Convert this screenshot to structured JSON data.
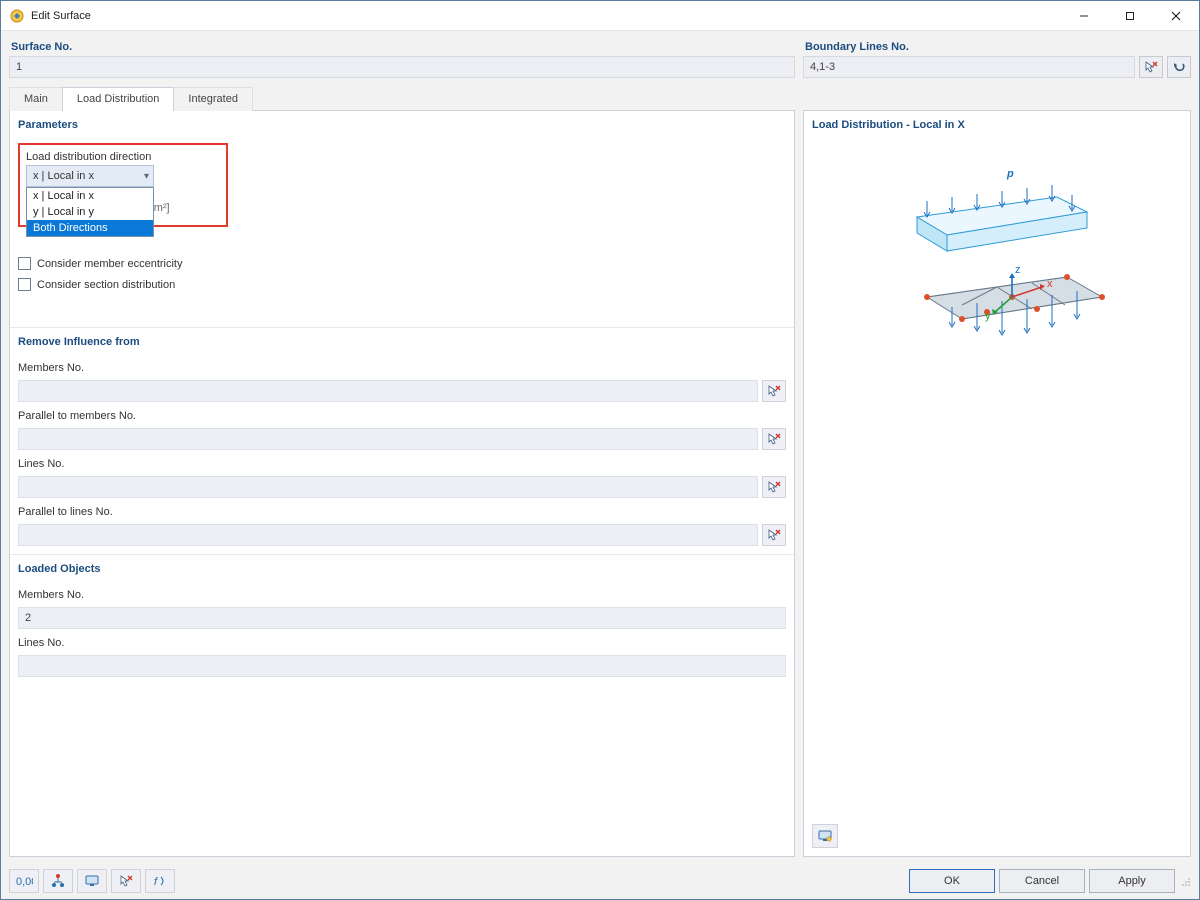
{
  "window": {
    "title": "Edit Surface"
  },
  "header": {
    "surface_no_label": "Surface No.",
    "surface_no_value": "1",
    "boundary_lines_label": "Boundary Lines No.",
    "boundary_lines_value": "4,1-3"
  },
  "tabs": {
    "main": "Main",
    "load_distribution": "Load Distribution",
    "integrated": "Integrated"
  },
  "parameters": {
    "title": "Parameters",
    "direction_label": "Load distribution direction",
    "direction_selected": "x | Local in x",
    "direction_options": [
      "x | Local in x",
      "y | Local in y",
      "Both Directions"
    ],
    "direction_highlighted_index": 2,
    "unit_value": "g",
    "unit_label": "[kg/m²]",
    "check_eccentricity": "Consider member eccentricity",
    "check_section_dist": "Consider section distribution"
  },
  "remove_influence": {
    "title": "Remove Influence from",
    "members_label": "Members No.",
    "members_value": "",
    "parallel_members_label": "Parallel to members No.",
    "parallel_members_value": "",
    "lines_label": "Lines No.",
    "lines_value": "",
    "parallel_lines_label": "Parallel to lines No.",
    "parallel_lines_value": ""
  },
  "loaded_objects": {
    "title": "Loaded Objects",
    "members_label": "Members No.",
    "members_value": "2",
    "lines_label": "Lines No.",
    "lines_value": ""
  },
  "preview": {
    "title": "Load Distribution - Local in X",
    "load_symbol": "p",
    "axes": {
      "x": "x",
      "y": "y",
      "z": "z"
    }
  },
  "buttons": {
    "ok": "OK",
    "cancel": "Cancel",
    "apply": "Apply"
  },
  "colors": {
    "accent": "#2779b8",
    "highlight_red": "#e33a2e",
    "highlight_blue": "#1d6fbf",
    "surface_fill": "#bfe6f7",
    "surface_stroke": "#2f9bd6",
    "node": "#e05028"
  }
}
